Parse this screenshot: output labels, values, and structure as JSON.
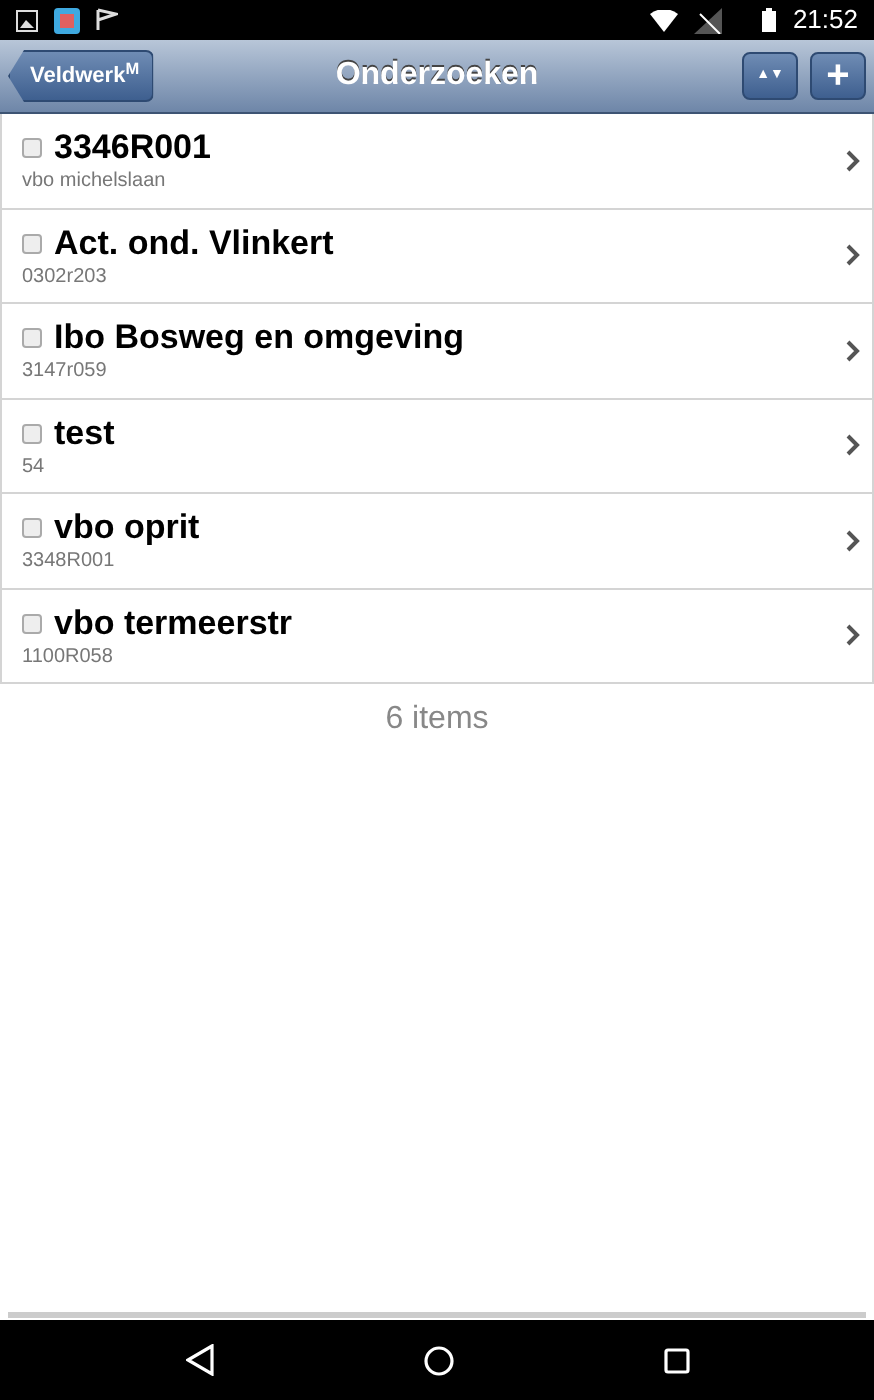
{
  "status_bar": {
    "time": "21:52"
  },
  "header": {
    "back": "Veldwerk$^{M}$",
    "title": "Onderzoeken",
    "sort": "▲▼",
    "add": "+"
  },
  "items": [
    {
      "title": "3346R001",
      "subtitle": "vbo michelslaan",
      "checked": false
    },
    {
      "title": "Act. ond. Vlinkert",
      "subtitle": "0302r203",
      "checked": false
    },
    {
      "title": "Ibo Bosweg en omgeving",
      "subtitle": "3147r059",
      "checked": false
    },
    {
      "title": "test",
      "subtitle": "54",
      "checked": false
    },
    {
      "title": "vbo oprit",
      "subtitle": "3348R001",
      "checked": false
    },
    {
      "title": "vbo termeerstr",
      "subtitle": "1100R058",
      "checked": false
    }
  ],
  "footer": "6 items"
}
